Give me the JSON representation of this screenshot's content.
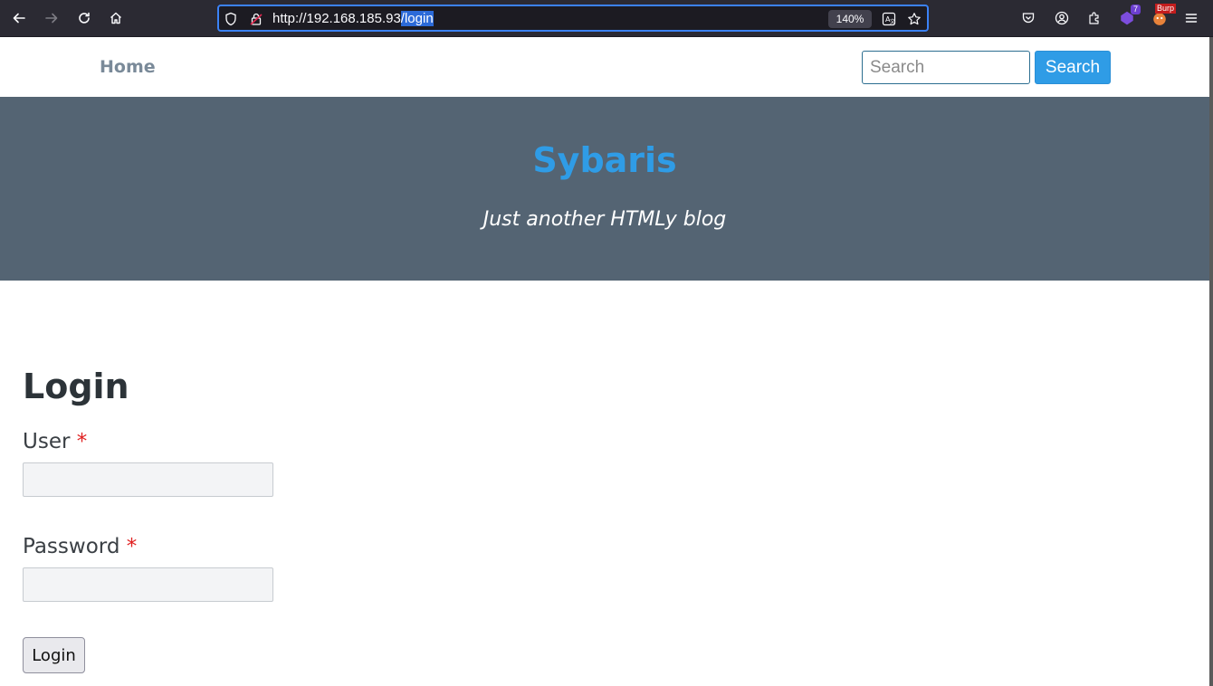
{
  "browser": {
    "url_host": "http://192.168.185.93",
    "url_path": "/login",
    "zoom": "140%",
    "extensions_badge": "7",
    "burp_label": "Burp",
    "colors": {
      "toolbar": "#2b2a33",
      "url_focus": "#3b82f6"
    }
  },
  "site": {
    "nav_home": "Home",
    "search_placeholder": "Search",
    "search_button": "Search",
    "title": "Sybaris",
    "tagline": "Just another HTMLy blog",
    "colors": {
      "accent": "#2f9ce6",
      "hero_bg": "#546473"
    }
  },
  "login": {
    "heading": "Login",
    "user_label": "User",
    "password_label": "Password",
    "required_marker": "*",
    "submit_label": "Login"
  }
}
